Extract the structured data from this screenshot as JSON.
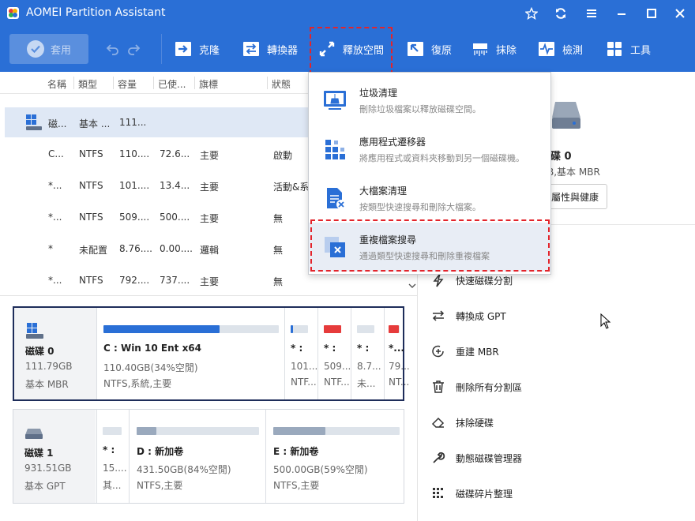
{
  "window": {
    "title": "AOMEI Partition Assistant"
  },
  "colors": {
    "brand": "#2a6fd6",
    "selected_row": "#dfe8f5",
    "disk_active_border": "#1e2d5a",
    "used_blue": "#2a6fd6",
    "used_red": "#e63b3b",
    "used_gray": "#9aa9bd",
    "callout_red": "#e3242b"
  },
  "toolbar": {
    "apply_label": "套用",
    "items": [
      {
        "label": "克隆",
        "icon": "clone-icon"
      },
      {
        "label": "轉換器",
        "icon": "converter-icon"
      },
      {
        "label": "釋放空間",
        "icon": "free-space-icon"
      },
      {
        "label": "復原",
        "icon": "recovery-icon"
      },
      {
        "label": "抹除",
        "icon": "wipe-icon"
      },
      {
        "label": "檢測",
        "icon": "test-icon"
      },
      {
        "label": "工具",
        "icon": "tools-icon"
      }
    ]
  },
  "table": {
    "headers": [
      "名稱",
      "類型",
      "容量",
      "已使...",
      "旗標",
      "狀態"
    ],
    "rows": [
      {
        "name": "磁...",
        "type": "基本 ...",
        "capacity": "111...",
        "used": "",
        "flag": "",
        "status": ""
      },
      {
        "name": "C...",
        "type": "NTFS",
        "capacity": "110....",
        "used": "72.6...",
        "flag": "主要",
        "status": "啟動"
      },
      {
        "name": "*...",
        "type": "NTFS",
        "capacity": "101....",
        "used": "13.4...",
        "flag": "主要",
        "status": "活動&系"
      },
      {
        "name": "*...",
        "type": "NTFS",
        "capacity": "509....",
        "used": "500....",
        "flag": "主要",
        "status": "無"
      },
      {
        "name": "*",
        "type": "未配置",
        "capacity": "8.76....",
        "used": "0.00....",
        "flag": "邏輯",
        "status": "無"
      },
      {
        "name": "*...",
        "type": "NTFS",
        "capacity": "792....",
        "used": "737....",
        "flag": "主要",
        "status": "無"
      }
    ]
  },
  "disks": [
    {
      "name": "磁碟 0",
      "size": "111.79GB",
      "type": "基本 MBR",
      "partitions": [
        {
          "label": "C : Win 10 Ent x64",
          "size": "110.40GB(34%空閒)",
          "fs": "NTFS,系統,主要",
          "used_fraction": 0.66,
          "color": "blue"
        },
        {
          "label": "* :",
          "size": "101...",
          "fs": "NTF...",
          "used_fraction": 0.15,
          "color": "blue"
        },
        {
          "label": "* :",
          "size": "509...",
          "fs": "NTF...",
          "used_fraction": 0.98,
          "color": "red"
        },
        {
          "label": "* :",
          "size": "8.7...",
          "fs": "未...",
          "used_fraction": 0.0,
          "color": "gray"
        },
        {
          "label": "*...",
          "size": "79...",
          "fs": "NT...",
          "used_fraction": 0.93,
          "color": "red"
        }
      ]
    },
    {
      "name": "磁碟 1",
      "size": "931.51GB",
      "type": "基本 GPT",
      "partitions": [
        {
          "label": "* :",
          "size": "15....",
          "fs": "其...",
          "used_fraction": 0.0,
          "color": "gray"
        },
        {
          "label": "D : 新加卷",
          "size": "431.50GB(84%空閒)",
          "fs": "NTFS,主要",
          "used_fraction": 0.16,
          "color": "gray"
        },
        {
          "label": "E : 新加卷",
          "size": "500.00GB(59%空閒)",
          "fs": "NTFS,主要",
          "used_fraction": 0.41,
          "color": "gray"
        }
      ]
    }
  ],
  "right_panel": {
    "disk_title": "碟 0",
    "disk_sub": "B,基本 MBR",
    "properties_button": "屬性與健康",
    "operations": [
      {
        "label": "快速磁碟分割",
        "icon": "lightning-icon"
      },
      {
        "label": "轉換成 GPT",
        "icon": "convert-arrows-icon"
      },
      {
        "label": "重建 MBR",
        "icon": "rebuild-plus-icon"
      },
      {
        "label": "刪除所有分割區",
        "icon": "trash-icon"
      },
      {
        "label": "抹除硬碟",
        "icon": "eraser-icon"
      },
      {
        "label": "動態磁碟管理器",
        "icon": "wrench-icon"
      },
      {
        "label": "磁碟碎片整理",
        "icon": "defrag-icon"
      }
    ]
  },
  "dropdown": {
    "items": [
      {
        "title": "垃圾清理",
        "desc": "刪除垃圾檔案以釋放磁碟空間。",
        "icon": "broom-icon"
      },
      {
        "title": "應用程式遷移器",
        "desc": "將應用程式或資料夾移動到另一個磁碟機。",
        "icon": "app-mover-icon"
      },
      {
        "title": "大檔案清理",
        "desc": "按類型快速搜尋和刪除大檔案。",
        "icon": "large-file-icon"
      },
      {
        "title": "重複檔案搜尋",
        "desc": "通過類型快速搜尋和刪除重複檔案",
        "icon": "duplicate-file-icon"
      }
    ]
  }
}
